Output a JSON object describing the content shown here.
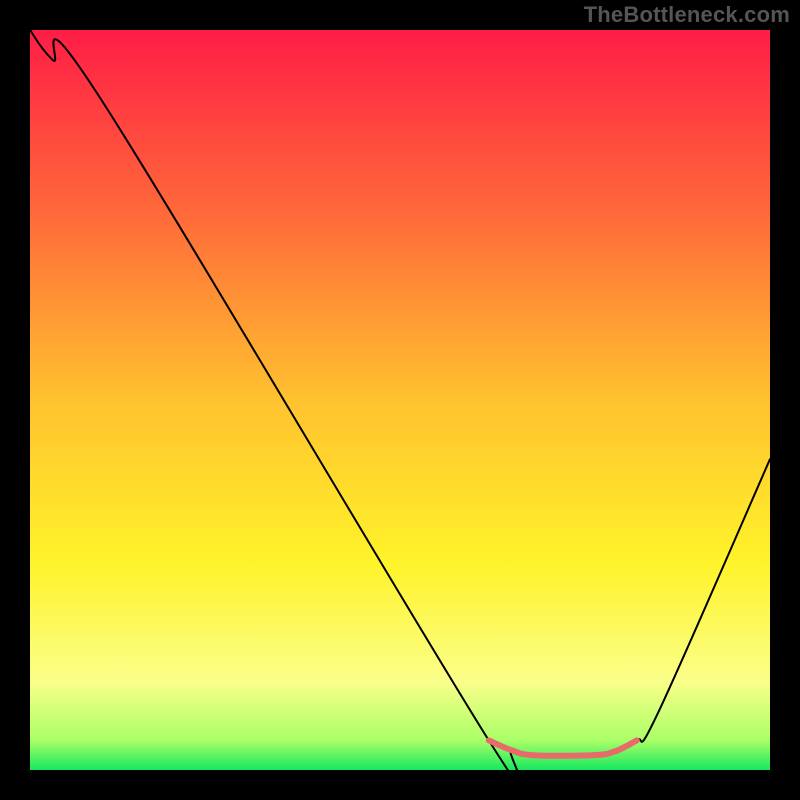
{
  "watermark": "TheBottleneck.com",
  "chart_data": {
    "type": "line",
    "title": "",
    "xlabel": "",
    "ylabel": "",
    "xlim": [
      0,
      100
    ],
    "ylim": [
      0,
      100
    ],
    "grid": false,
    "legend": false,
    "gradient_stops": [
      {
        "offset": 0,
        "color": "#ff1d46"
      },
      {
        "offset": 25,
        "color": "#ff6a3a"
      },
      {
        "offset": 50,
        "color": "#ffc22f"
      },
      {
        "offset": 72,
        "color": "#fff32a"
      },
      {
        "offset": 88,
        "color": "#fbff8a"
      },
      {
        "offset": 96,
        "color": "#a9ff67"
      },
      {
        "offset": 100,
        "color": "#17e85f"
      }
    ],
    "series": [
      {
        "name": "bottleneck-curve",
        "color": "#000000",
        "x": [
          0,
          3,
          10,
          62,
          65,
          68,
          76,
          79,
          82,
          85,
          100
        ],
        "values": [
          100,
          96,
          90,
          4,
          2.7,
          2,
          2,
          2.5,
          4,
          8,
          42
        ]
      }
    ],
    "highlight": {
      "name": "valley-flat",
      "color": "#e86a6a",
      "stroke_width": 6,
      "x": [
        62,
        65,
        68,
        76,
        79,
        82
      ],
      "values": [
        4.0,
        2.7,
        2.0,
        2.0,
        2.5,
        4.0
      ]
    }
  }
}
